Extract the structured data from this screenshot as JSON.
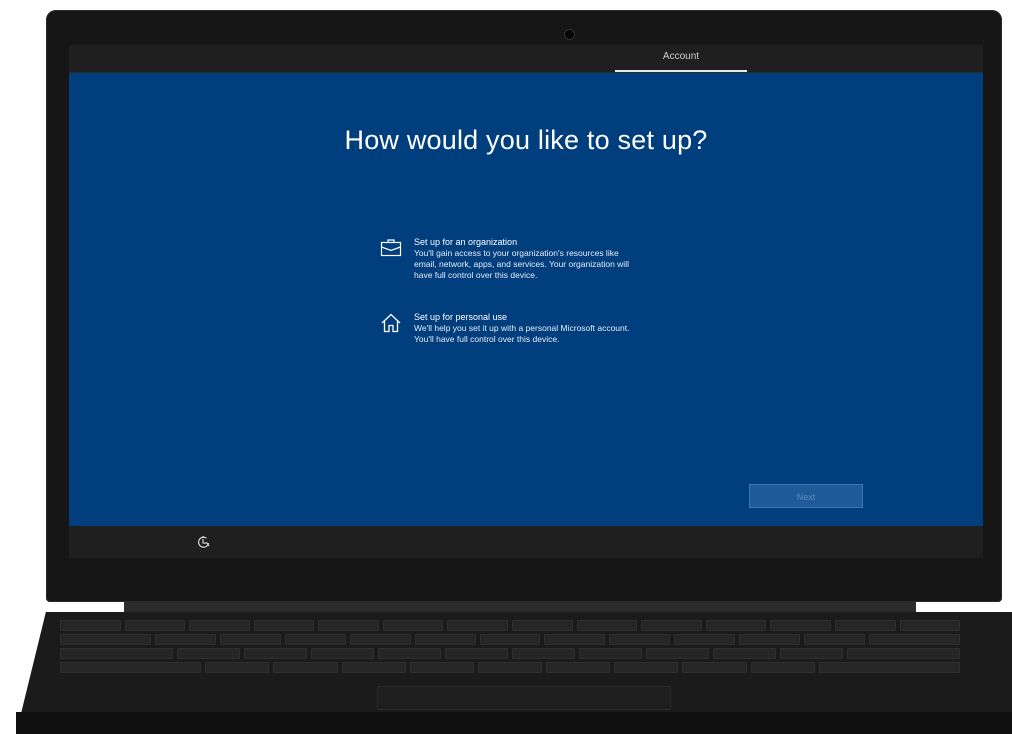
{
  "window": {
    "tabs": [
      {
        "label": "Account",
        "active": true
      }
    ]
  },
  "setup": {
    "heading": "How would you like to set up?",
    "options": [
      {
        "icon": "briefcase-icon",
        "title": "Set up for an organization",
        "description_lines": [
          "You'll gain access to your organization's resources like",
          "email, network, apps, and services. Your organization will",
          "have full control over this device."
        ]
      },
      {
        "icon": "home-icon",
        "title": "Set up for personal use",
        "description_lines": [
          "We'll help you set it up with a personal Microsoft account.",
          "You'll have full control over this device."
        ]
      }
    ],
    "next_label": "Next",
    "next_enabled": false
  },
  "footer": {
    "icon": "accessibility-icon"
  },
  "colors": {
    "background": "#003e7e",
    "bezel": "#161616",
    "bar": "#1f1f1f",
    "next_disabled_bg": "#1f5b9a",
    "next_disabled_text": "#5f8ab8"
  }
}
